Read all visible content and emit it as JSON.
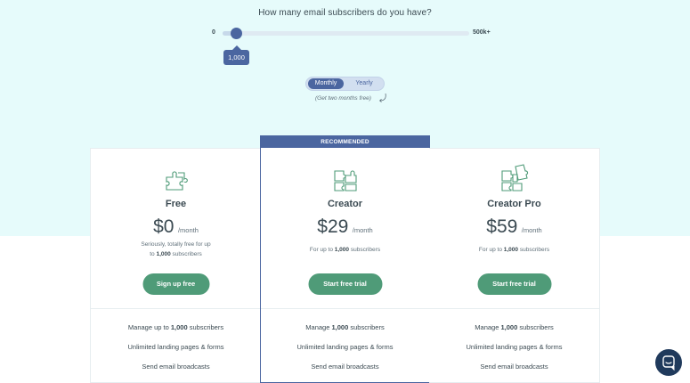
{
  "slider": {
    "question": "How many email subscribers do you have?",
    "min_label": "0",
    "max_label": "500k+",
    "value_label": "1,000",
    "position_fraction": 0.05
  },
  "billing_toggle": {
    "monthly": "Monthly",
    "yearly": "Yearly",
    "selected": "Monthly",
    "note": "(Get two months free)"
  },
  "plans": [
    {
      "name": "Free",
      "icon": "puzzle-piece-icon",
      "price": "$0",
      "period": "/month",
      "desc_line1": "Seriously, totally free for up",
      "desc_line2_prefix": "to ",
      "desc_line2_bold": "1,000",
      "desc_line2_suffix": " subscribers",
      "cta": "Sign up free",
      "features": {
        "f1_prefix": "Manage up to ",
        "f1_bold": "1,000",
        "f1_suffix": " subscribers",
        "f2": "Unlimited landing pages & forms",
        "f3": "Send email broadcasts"
      }
    },
    {
      "name": "Creator",
      "icon": "puzzle-pieces-icon",
      "badge": "RECOMMENDED",
      "price": "$29",
      "period": "/month",
      "desc_prefix": "For up to ",
      "desc_bold": "1,000",
      "desc_suffix": " subscribers",
      "cta": "Start free trial",
      "features": {
        "f1_prefix": "Manage ",
        "f1_bold": "1,000",
        "f1_suffix": " subscribers",
        "f2": "Unlimited landing pages & forms",
        "f3": "Send email broadcasts"
      }
    },
    {
      "name": "Creator Pro",
      "icon": "puzzle-stack-icon",
      "price": "$59",
      "period": "/month",
      "desc_prefix": "For up to ",
      "desc_bold": "1,000",
      "desc_suffix": " subscribers",
      "cta": "Start free trial",
      "features": {
        "f1_prefix": "Manage ",
        "f1_bold": "1,000",
        "f1_suffix": " subscribers",
        "f2": "Unlimited landing pages & forms",
        "f3": "Send email broadcasts"
      }
    }
  ],
  "chat_widget": {
    "icon": "chat-icon"
  },
  "colors": {
    "accent": "#4b66a0",
    "cta": "#4f9b78",
    "top_background": "#e6fbfb",
    "chat": "#203a5c"
  }
}
